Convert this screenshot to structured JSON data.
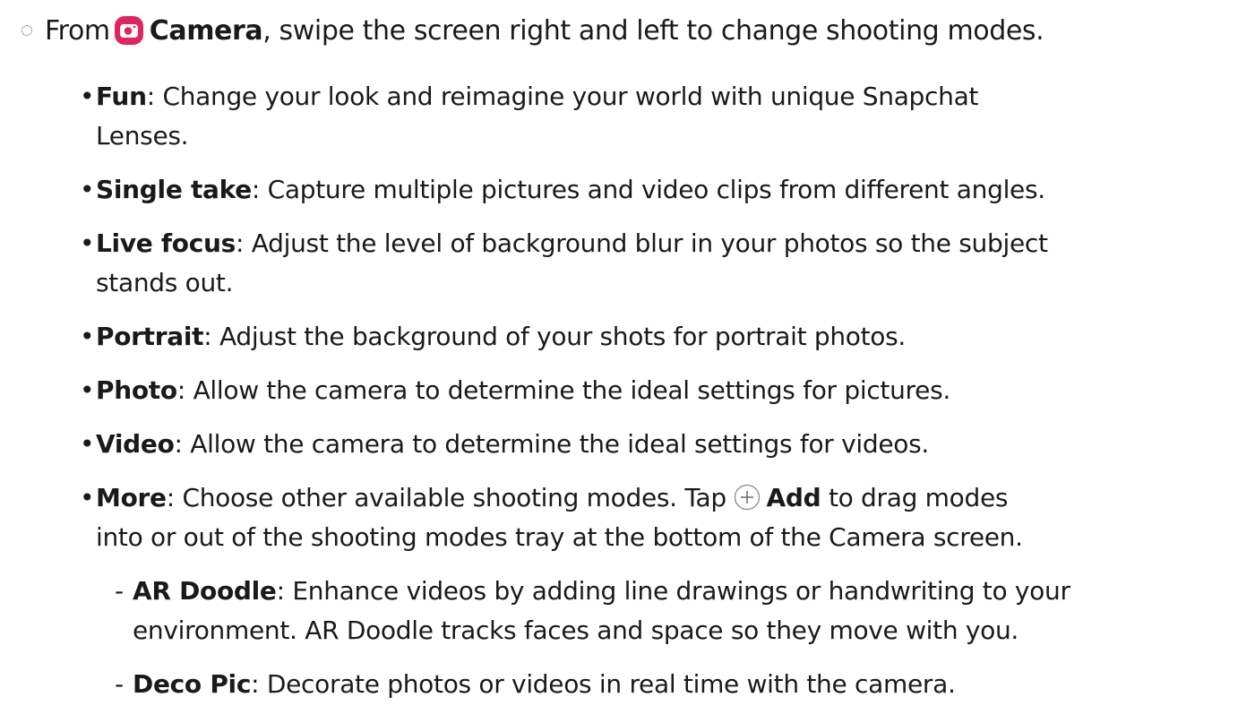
{
  "intro": {
    "prefix": "From",
    "app_icon": "camera-icon",
    "app_name": "Camera",
    "suffix": ", swipe the screen right and left to change shooting modes."
  },
  "modes": [
    {
      "name": "Fun",
      "lines": [
        "Change your look and reimagine your world with unique Snapchat",
        "Lenses."
      ]
    },
    {
      "name": "Single take",
      "lines": [
        "Capture multiple pictures and video clips from different angles."
      ]
    },
    {
      "name": "Live focus",
      "lines": [
        "Adjust the level of background blur in your photos so the subject",
        "stands out."
      ]
    },
    {
      "name": "Portrait",
      "lines": [
        "Adjust the background of your shots for portrait photos."
      ]
    },
    {
      "name": "Photo",
      "lines": [
        "Allow the camera to determine the ideal settings for pictures."
      ]
    },
    {
      "name": "Video",
      "lines": [
        "Allow the camera to determine the ideal settings for videos."
      ]
    },
    {
      "name": "More",
      "line1_before": "Choose other available shooting modes. Tap",
      "add_icon": "plus-circle-icon",
      "add_label": "Add",
      "line1_after": "to drag modes",
      "line2": "into or out of the shooting modes tray at the bottom of the Camera screen."
    }
  ],
  "submodes": [
    {
      "name": "AR Doodle",
      "lines": [
        "Enhance videos by adding line drawings or handwriting to your",
        "environment. AR Doodle tracks faces and space so they move with you."
      ]
    },
    {
      "name": "Deco Pic",
      "lines": [
        "Decorate photos or videos in real time with the camera."
      ]
    }
  ],
  "colors": {
    "camera_icon": "#e0245e",
    "text": "#1a1a1a"
  }
}
